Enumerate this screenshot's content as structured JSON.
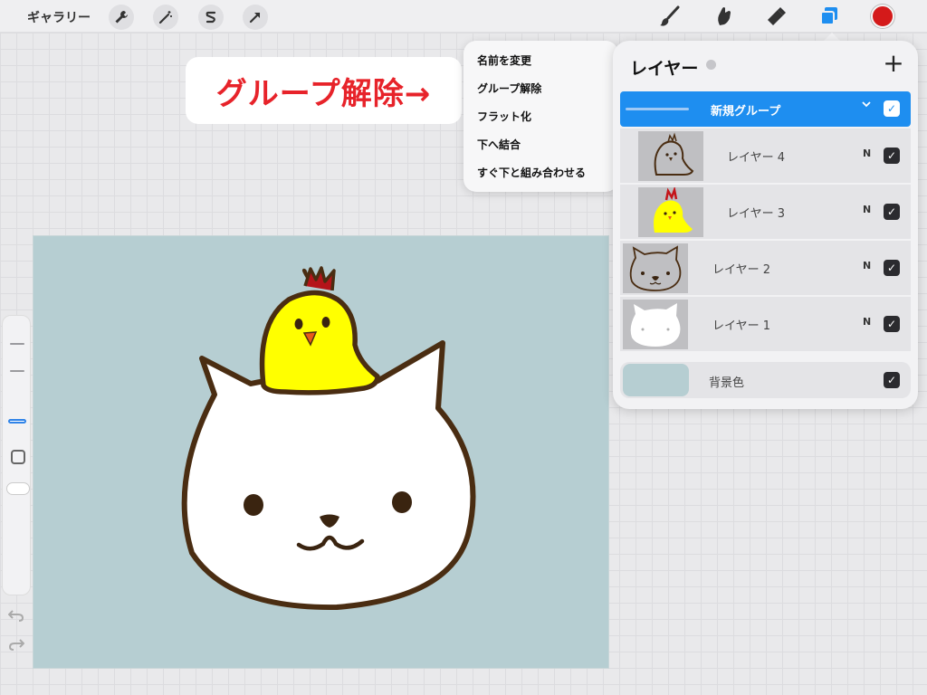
{
  "topbar": {
    "gallery_label": "ギャラリー",
    "left_tools": [
      "wrench-icon",
      "magic-wand-icon",
      "selection-icon",
      "transform-arrow-icon"
    ],
    "right_tools": [
      "brush-icon",
      "smudge-icon",
      "eraser-icon",
      "layers-icon"
    ],
    "current_color": "#d41a1a",
    "accent_color": "#1e8ef0"
  },
  "callout": {
    "text": "グループ解除→",
    "color": "#e7232a"
  },
  "context_menu": {
    "items": [
      "名前を変更",
      "グループ解除",
      "フラット化",
      "下へ結合",
      "すぐ下と組み合わせる"
    ]
  },
  "layers_panel": {
    "title": "レイヤー",
    "add_label": "+",
    "group": {
      "name": "新規グループ",
      "checked": true
    },
    "layers": [
      {
        "name": "レイヤー 4",
        "blend": "N",
        "checked": true,
        "thumb": "chick-outline"
      },
      {
        "name": "レイヤー 3",
        "blend": "N",
        "checked": true,
        "thumb": "chick-yellow"
      },
      {
        "name": "レイヤー 2",
        "blend": "N",
        "checked": true,
        "thumb": "cat-outline"
      },
      {
        "name": "レイヤー 1",
        "blend": "N",
        "checked": true,
        "thumb": "cat-white"
      }
    ],
    "background": {
      "name": "背景色",
      "color": "#b6ced2",
      "checked": true
    }
  },
  "canvas": {
    "background_color": "#b6ced2"
  }
}
